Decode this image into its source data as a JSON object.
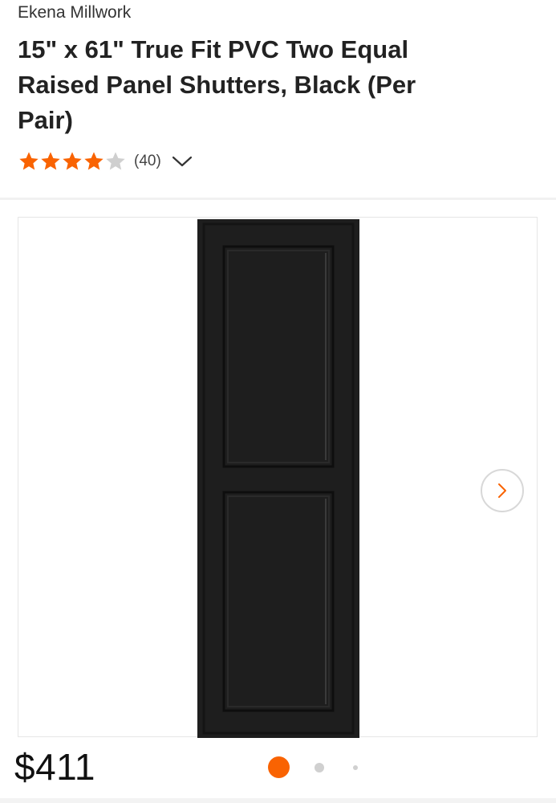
{
  "product": {
    "brand": "Ekena Millwork",
    "title": "15\" x 61\" True Fit PVC Two Equal Raised Panel Shutters, Black (Per Pair)",
    "rating": {
      "value": 4,
      "max": 5,
      "count_label": "(40)",
      "star_color": "#f96302",
      "empty_star_color": "#cfcfcf"
    },
    "price": "$411"
  },
  "gallery": {
    "current_index": 1,
    "total_images": 3,
    "next_icon": "chevron-right-icon",
    "dot_active_color": "#f96302",
    "dot_inactive_color": "#d0d0d0"
  },
  "colors": {
    "accent": "#f96302",
    "shutter": "#1e1e1e"
  }
}
